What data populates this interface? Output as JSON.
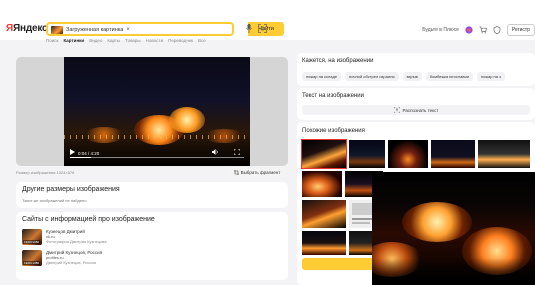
{
  "header": {
    "logo_text": "Яндекс",
    "search_chip_text": "Загруженная картинка",
    "search_chip_close": "×",
    "find_button": "Найти",
    "nav_tabs": [
      "Поиск",
      "Картинки",
      "Видео",
      "Карты",
      "Товары",
      "Новости",
      "Переводчик",
      "Все"
    ],
    "active_tab": "Картинки",
    "right_link": "Будьте в Плюсе",
    "login_button": "Регистр",
    "accent_color": "#ffcc33"
  },
  "player": {
    "time": "0:04 / 4:20",
    "watermark": "",
    "size_info": "Размер изображения 1024×576",
    "fragment_button": "Выбрать фрагмент",
    "progress": 0.12
  },
  "other_sizes": {
    "title": "Другие размеры изображения",
    "subtitle": "Таких же изображений не найдено"
  },
  "sites": {
    "title": "Сайты с информацией про изображение",
    "items": [
      {
        "name": "Кузнецов Дмитрий",
        "domain": "vk.ru",
        "desc": "Фотографии Дмитрия Кузнецова",
        "dims": "1920×1080"
      },
      {
        "name": "Дмитрий Кузнецов, Россия",
        "domain": "profiles.ru",
        "desc": "Дмитрий Кузнецов, Россия",
        "dims": "1920×1080"
      }
    ]
  },
  "seems": {
    "title": "Кажется, на изображении",
    "tags": [
      "пожар на складе",
      "ночной обстрел израиля",
      "взрыв",
      "бомбежка югославии",
      "пожар на з"
    ]
  },
  "text_on_image": {
    "title": "Текст на изображении",
    "recognize_button": "Распознать текст"
  },
  "similar": {
    "title": "Похожие изображения"
  }
}
